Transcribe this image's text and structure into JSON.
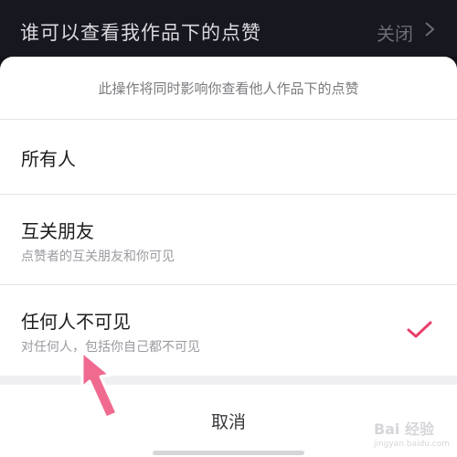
{
  "topbar": {
    "title": "谁可以查看我作品下的点赞",
    "value": "关闭"
  },
  "sheet": {
    "hint": "此操作将同时影响你查看他人作品下的点赞",
    "options": [
      {
        "label": "所有人",
        "description": ""
      },
      {
        "label": "互关朋友",
        "description": "点赞者的互关朋友和你可见"
      },
      {
        "label": "任何人不可见",
        "description": "对任何人，包括你自己都不可见",
        "selected": true
      }
    ],
    "cancel_label": "取消"
  },
  "watermark": {
    "brand": "Bai 经验",
    "url": "jingyan.baidu.com"
  },
  "colors": {
    "accent": "#e8406a",
    "topbar_bg": "#17171f"
  }
}
